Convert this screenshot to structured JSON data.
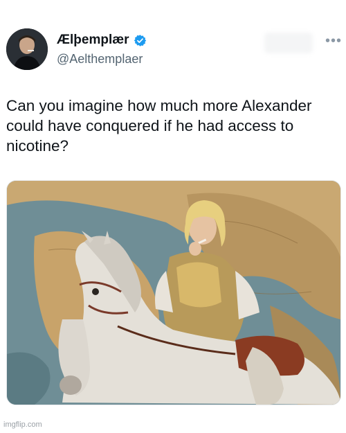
{
  "tweet": {
    "display_name": "Ælþemplær",
    "handle": "@Aelthemplaer",
    "text": "Can you imagine how much more Alexander could have conquered if he had access to nicotine?",
    "verified_icon": "verified-badge-icon",
    "more_icon": "more-options-icon"
  },
  "media": {
    "description_icon": "painting-image"
  },
  "watermark": "imgflip.com",
  "colors": {
    "verified_blue": "#1d9bf0",
    "handle_gray": "#536471",
    "text_dark": "#0f1419"
  }
}
